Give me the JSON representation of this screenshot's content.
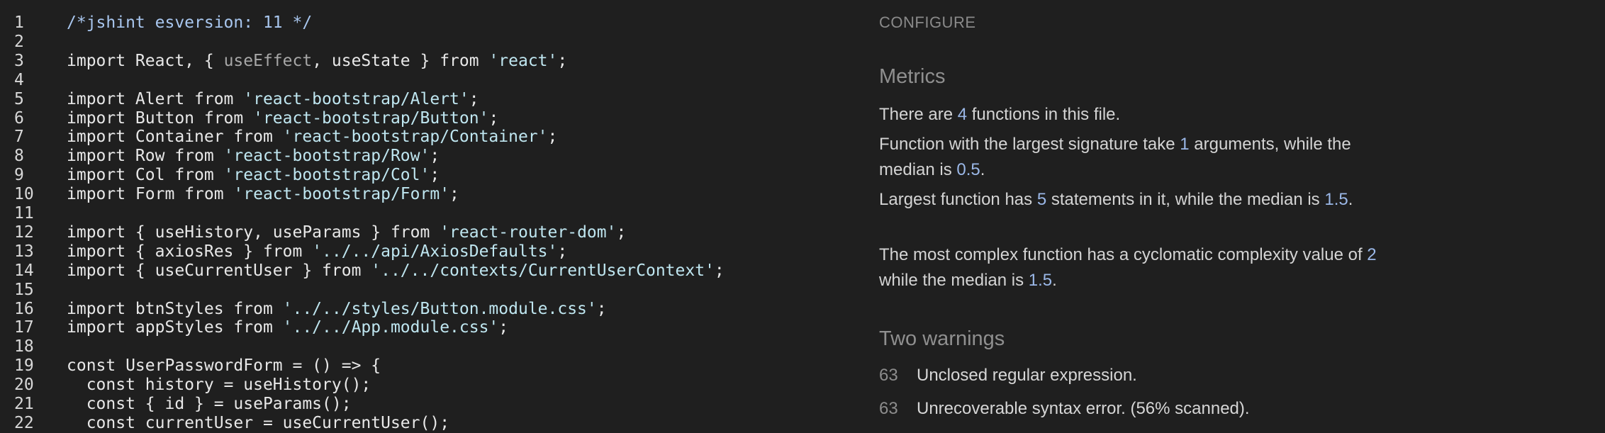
{
  "editor": {
    "lines": [
      {
        "n": "1",
        "tokens": [
          {
            "t": "/*jshint esversion: 11 */",
            "c": "comment"
          }
        ]
      },
      {
        "n": "2",
        "tokens": []
      },
      {
        "n": "3",
        "tokens": [
          {
            "t": "import React, { "
          },
          {
            "t": "useEffect",
            "c": "dim"
          },
          {
            "t": ", useState } from "
          },
          {
            "t": "'react'",
            "c": "str"
          },
          {
            "t": ";"
          }
        ]
      },
      {
        "n": "4",
        "tokens": []
      },
      {
        "n": "5",
        "tokens": [
          {
            "t": "import Alert from "
          },
          {
            "t": "'react-bootstrap/Alert'",
            "c": "str"
          },
          {
            "t": ";"
          }
        ]
      },
      {
        "n": "6",
        "tokens": [
          {
            "t": "import Button from "
          },
          {
            "t": "'react-bootstrap/Button'",
            "c": "str"
          },
          {
            "t": ";"
          }
        ]
      },
      {
        "n": "7",
        "tokens": [
          {
            "t": "import Container from "
          },
          {
            "t": "'react-bootstrap/Container'",
            "c": "str"
          },
          {
            "t": ";"
          }
        ]
      },
      {
        "n": "8",
        "tokens": [
          {
            "t": "import Row from "
          },
          {
            "t": "'react-bootstrap/Row'",
            "c": "str"
          },
          {
            "t": ";"
          }
        ]
      },
      {
        "n": "9",
        "tokens": [
          {
            "t": "import Col from "
          },
          {
            "t": "'react-bootstrap/Col'",
            "c": "str"
          },
          {
            "t": ";"
          }
        ]
      },
      {
        "n": "10",
        "tokens": [
          {
            "t": "import Form from "
          },
          {
            "t": "'react-bootstrap/Form'",
            "c": "str"
          },
          {
            "t": ";"
          }
        ]
      },
      {
        "n": "11",
        "tokens": []
      },
      {
        "n": "12",
        "tokens": [
          {
            "t": "import { useHistory, useParams } from "
          },
          {
            "t": "'react-router-dom'",
            "c": "str"
          },
          {
            "t": ";"
          }
        ]
      },
      {
        "n": "13",
        "tokens": [
          {
            "t": "import { axiosRes } from "
          },
          {
            "t": "'../../api/AxiosDefaults'",
            "c": "str"
          },
          {
            "t": ";"
          }
        ]
      },
      {
        "n": "14",
        "tokens": [
          {
            "t": "import { useCurrentUser } from "
          },
          {
            "t": "'../../contexts/CurrentUserContext'",
            "c": "str"
          },
          {
            "t": ";"
          }
        ]
      },
      {
        "n": "15",
        "tokens": []
      },
      {
        "n": "16",
        "tokens": [
          {
            "t": "import btnStyles from "
          },
          {
            "t": "'../../styles/Button.module.css'",
            "c": "str"
          },
          {
            "t": ";"
          }
        ]
      },
      {
        "n": "17",
        "tokens": [
          {
            "t": "import appStyles from "
          },
          {
            "t": "'../../App.module.css'",
            "c": "str"
          },
          {
            "t": ";"
          }
        ]
      },
      {
        "n": "18",
        "tokens": []
      },
      {
        "n": "19",
        "tokens": [
          {
            "t": "const UserPasswordForm = () => {"
          }
        ]
      },
      {
        "n": "20",
        "tokens": [
          {
            "t": "  const history = useHistory();"
          }
        ]
      },
      {
        "n": "21",
        "tokens": [
          {
            "t": "  const { id } = useParams();"
          }
        ]
      },
      {
        "n": "22",
        "tokens": [
          {
            "t": "  const currentUser = useCurrentUser();"
          }
        ]
      }
    ]
  },
  "panel": {
    "configure_label": "CONFIGURE",
    "metrics_heading": "Metrics",
    "metrics": {
      "functions_prefix": "There are ",
      "functions_count": "4",
      "functions_suffix": " functions in this file.",
      "sig_prefix": "Function with the largest signature take ",
      "sig_value": "1",
      "sig_middle": " arguments, while the median is ",
      "sig_median": "0.5",
      "sig_suffix": ".",
      "size_prefix": "Largest function has ",
      "size_value": "5",
      "size_middle": " statements in it, while the median is ",
      "size_median": "1.5",
      "size_suffix": ".",
      "cc_prefix": "The most complex function has a cyclomatic complexity value of ",
      "cc_value": "2",
      "cc_middle": " while the median is ",
      "cc_median": "1.5",
      "cc_suffix": "."
    },
    "warnings_heading": "Two warnings",
    "warnings": [
      {
        "line": "63",
        "message": "Unclosed regular expression."
      },
      {
        "line": "63",
        "message": "Unrecoverable syntax error. (56% scanned)."
      }
    ]
  }
}
